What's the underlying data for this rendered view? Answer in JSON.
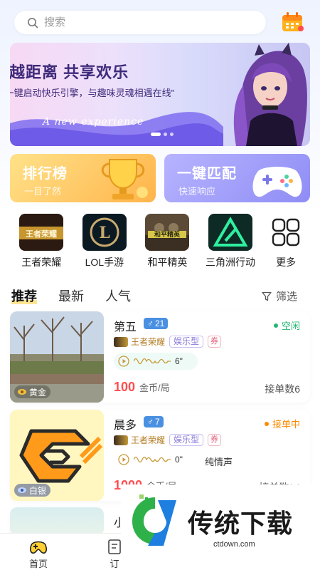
{
  "search": {
    "placeholder": "搜索"
  },
  "banner": {
    "title": "跨越距离 共享欢乐",
    "subtitle": "\"一键启动快乐引擎，与趣味灵魂相遇在线\"",
    "english": "A new experience"
  },
  "features": {
    "rank": {
      "title": "排行榜",
      "subtitle": "一目了然"
    },
    "match": {
      "title": "一键匹配",
      "subtitle": "快速响应"
    }
  },
  "games": [
    {
      "label": "王者荣耀",
      "icon": "honor-of-kings-icon"
    },
    {
      "label": "LOL手游",
      "icon": "lol-icon"
    },
    {
      "label": "和平精英",
      "icon": "peace-elite-icon"
    },
    {
      "label": "三角洲行动",
      "icon": "delta-force-icon"
    },
    {
      "label": "更多",
      "icon": "grid-icon"
    }
  ],
  "tabs": [
    "推荐",
    "最新",
    "人气"
  ],
  "filter_label": "筛选",
  "list": [
    {
      "name": "第五",
      "gender": "♂",
      "age": "21",
      "status": "空闲",
      "status_color": "#22b573",
      "game": "王者荣耀",
      "type": "娱乐型",
      "coupon": "券",
      "voice_len": "6\"",
      "voice_note": "",
      "price": "100",
      "unit": "金币/局",
      "orders": "接单数6",
      "tier": "黄金"
    },
    {
      "name": "晨多",
      "gender": "♂",
      "age": "7",
      "status": "接单中",
      "status_color": "#ff8a00",
      "game": "王者荣耀",
      "type": "娱乐型",
      "coupon": "券",
      "voice_len": "0\"",
      "voice_note": "纯情声",
      "price": "1000",
      "unit": "金币/局",
      "orders": "接单数14",
      "tier": "白银"
    },
    {
      "name": "小"
    }
  ],
  "bottom_nav": [
    {
      "label": "首页"
    },
    {
      "label": "订"
    }
  ],
  "watermark": {
    "text": "传统下载",
    "url": "ctdown.com"
  },
  "colors": {
    "accent": "#ff4d4f",
    "idle": "#22b573",
    "busy": "#ff8a00",
    "rank": "#ffb44a",
    "match": "#8f8df5"
  }
}
